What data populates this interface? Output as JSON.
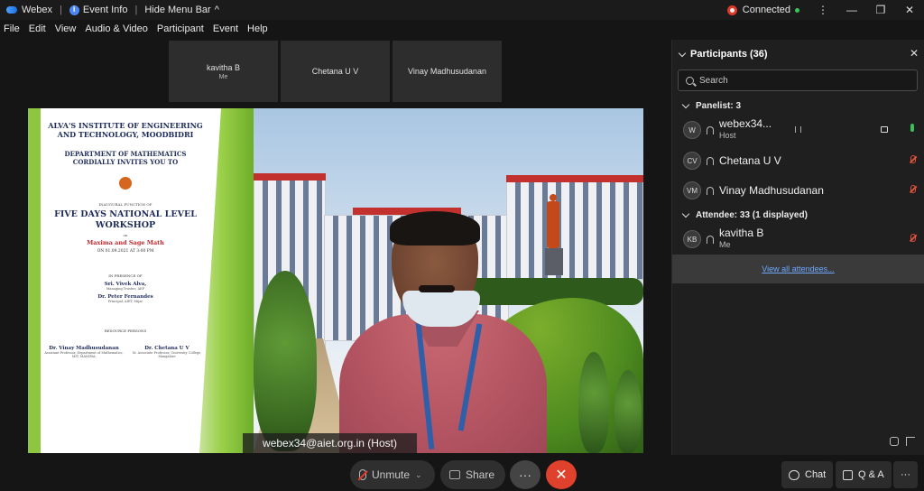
{
  "titlebar": {
    "app_name": "Webex",
    "event_info": "Event Info",
    "hide_menu": "Hide Menu Bar",
    "hide_menu_caret": "^",
    "status": "Connected",
    "win_more": "⋮",
    "win_min": "—",
    "win_max": "❐",
    "win_close": "✕"
  },
  "menu": [
    "File",
    "Edit",
    "View",
    "Audio & Video",
    "Participant",
    "Event",
    "Help"
  ],
  "thumbnails": [
    {
      "name": "kavitha B",
      "sub": "Me"
    },
    {
      "name": "Chetana U V",
      "sub": ""
    },
    {
      "name": "Vinay Madhusudanan",
      "sub": ""
    }
  ],
  "stage": {
    "poster": {
      "inst": "ALVA'S INSTITUTE OF ENGINEERING AND TECHNOLOGY, MOODBIDRI",
      "dept": "DEPARTMENT OF MATHEMATICS CORDIALLY INVITES YOU TO",
      "inaug": "INAUGURAL FUNCTION OF",
      "workshop": "FIVE DAYS NATIONAL LEVEL WORKSHOP",
      "on": "on",
      "topic": "Maxima and Sage Math",
      "date": "ON 01.09.2021 AT 3:00 PM",
      "presence": "IN PRESENCE OF",
      "guest1_name": "Sri. Vivek Alva,",
      "guest1_role": "Managing Trustee, AEF",
      "guest2_name": "Dr. Peter Fernandes",
      "guest2_role": "Principal, AIET, Mijar",
      "resource": "RESOURCE PERSONS",
      "rp1_name": "Dr. Vinay Madhusudanan",
      "rp1_role": "Assistant Professor, Department of Mathematics, MIT, MANIPAL",
      "rp2_name": "Dr. Chetana U V",
      "rp2_role": "Sr. Associate Professor, University College, Mangalore"
    },
    "speaker_label": "webex34@aiet.org.in (Host)"
  },
  "toolbar": {
    "unmute": "Unmute",
    "unmute_caret": "⌄",
    "share": "Share",
    "more": "···",
    "leave": "✕"
  },
  "panel": {
    "title": "Participants (36)",
    "close": "✕",
    "search_placeholder": "Search",
    "panelist_header": "Panelist: 3",
    "attendee_header": "Attendee: 33 (1 displayed)",
    "panelists": [
      {
        "initials": "W",
        "name": "webex34...",
        "role": "Host"
      },
      {
        "initials": "CV",
        "name": "Chetana U V",
        "role": ""
      },
      {
        "initials": "VM",
        "name": "Vinay Madhusudanan",
        "role": ""
      }
    ],
    "attendees": [
      {
        "initials": "KB",
        "name": "kavitha B",
        "role": "Me"
      }
    ],
    "view_all": "View all attendees..."
  },
  "bottom_right": {
    "chat": "Chat",
    "qa": "Q & A",
    "more": "···"
  }
}
